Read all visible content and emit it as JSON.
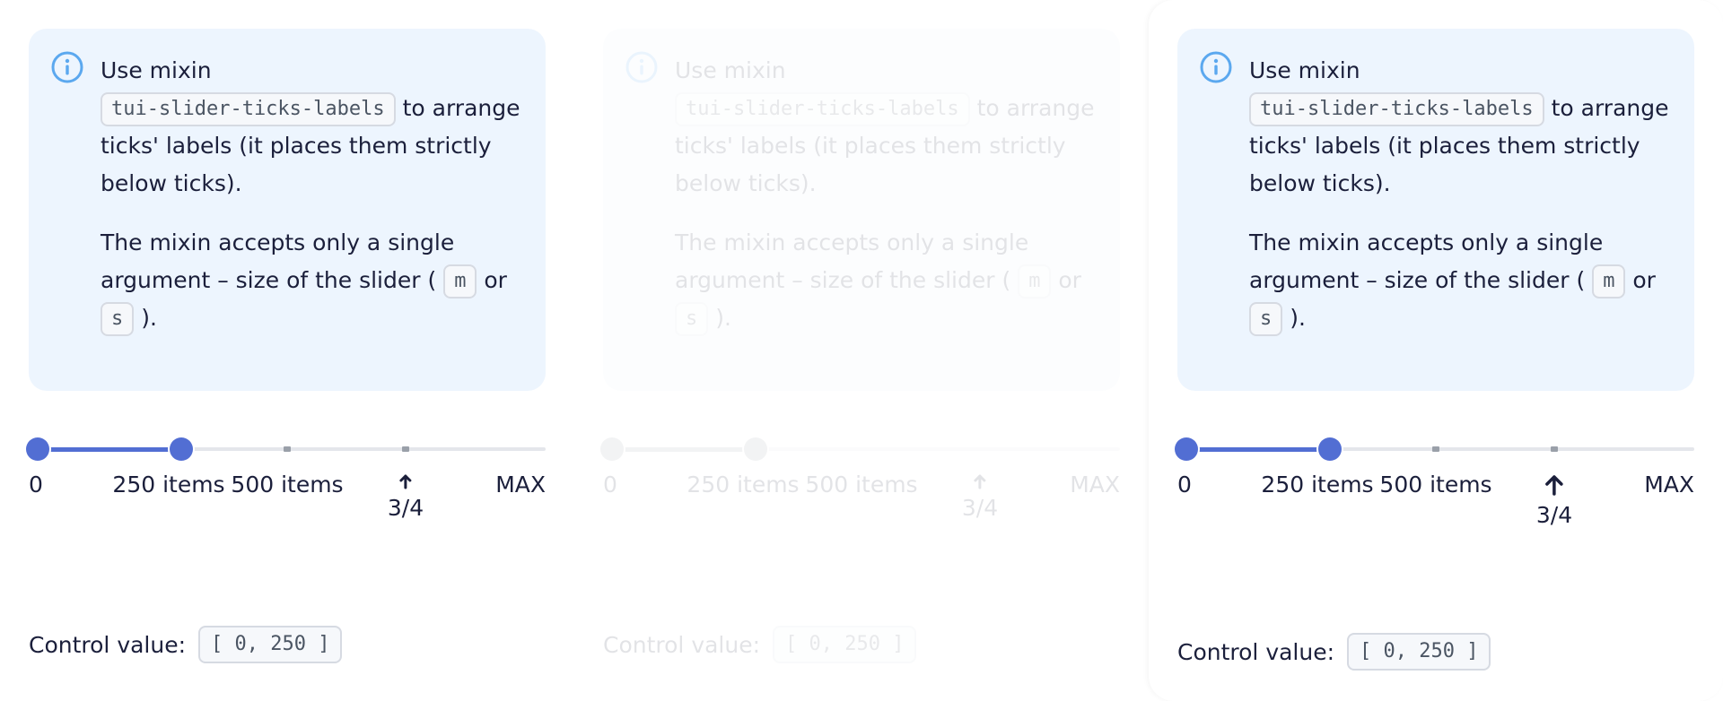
{
  "notification": {
    "line_prefix": "Use mixin",
    "code_label": "tui-slider-ticks-labels",
    "line_suffix": "to arrange ticks' labels (it places them strictly below ticks).",
    "second_prefix": "The mixin accepts only a single argument – size of the slider (",
    "size_m": "m",
    "size_or": "or",
    "size_s": "s",
    "second_suffix": ")."
  },
  "slider": {
    "min": 0,
    "max": 1000,
    "value": [
      0,
      250
    ],
    "labels": [
      "0",
      "250 items",
      "500 items",
      "3/4",
      "MAX"
    ]
  },
  "control": {
    "label": "Control value:",
    "value": "[ 0, 250 ]"
  },
  "colors": {
    "accent": "#526ed3",
    "info_bg": "#edf5fe",
    "info_icon": "#5ba8ef"
  }
}
